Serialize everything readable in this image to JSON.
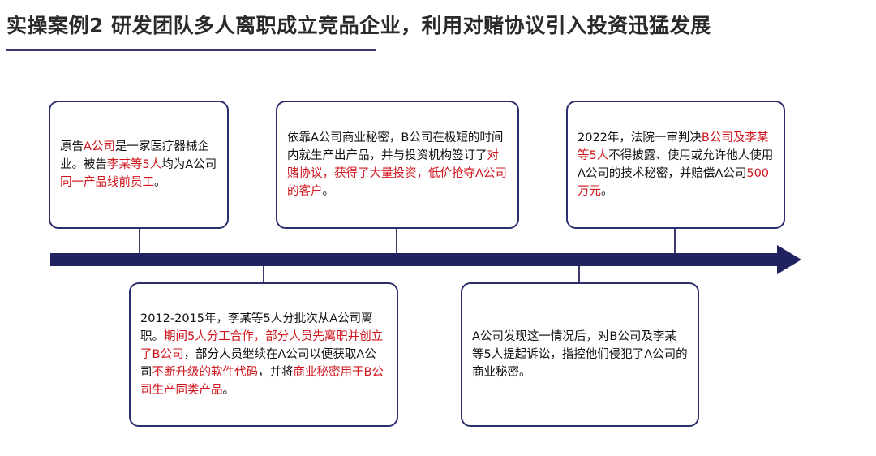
{
  "header": {
    "title": "实操案例2  研发团队多人离职成立竞品企业，利用对赌协议引入投资迅猛发展"
  },
  "timeline": {
    "colors": {
      "bar": "#212260",
      "border": "#2c2d6e",
      "highlight": "#d0141c"
    },
    "events": [
      {
        "position": "top",
        "segments": [
          {
            "text": "原告",
            "highlight": false
          },
          {
            "text": "A公司",
            "highlight": true
          },
          {
            "text": "是一家医疗器械企业。被告",
            "highlight": false
          },
          {
            "text": "李某等5人",
            "highlight": true
          },
          {
            "text": "均为A公司",
            "highlight": false
          },
          {
            "text": "同一产品线前员工",
            "highlight": true
          },
          {
            "text": "。",
            "highlight": false
          }
        ]
      },
      {
        "position": "bottom",
        "segments": [
          {
            "text": "2012-2015年，李某等5人分批次从A公司离职。",
            "highlight": false
          },
          {
            "text": "期间5人分工合作，部分人员先离职并创立了B公司",
            "highlight": true
          },
          {
            "text": "，部分人员继续在A公司以便获取A公司",
            "highlight": false
          },
          {
            "text": "不断升级的软件代码",
            "highlight": true
          },
          {
            "text": "，并将",
            "highlight": false
          },
          {
            "text": "商业秘密用于B公司生产同类产品",
            "highlight": true
          },
          {
            "text": "。",
            "highlight": false
          }
        ]
      },
      {
        "position": "top",
        "segments": [
          {
            "text": "依靠A公司商业秘密，B公司在极短的时间内就生产出产品，并与投资机构签订了",
            "highlight": false
          },
          {
            "text": "对赌协议，获得了大量投资，低价抢夺A公司的客户",
            "highlight": true
          },
          {
            "text": "。",
            "highlight": false
          }
        ]
      },
      {
        "position": "bottom",
        "segments": [
          {
            "text": "A公司发现这一情况后，对B公司及李某等5人提起诉讼，指控他们侵犯了A公司的商业秘密。",
            "highlight": false
          }
        ]
      },
      {
        "position": "top",
        "segments": [
          {
            "text": "2022年，法院一审判决",
            "highlight": false
          },
          {
            "text": "B公司及李某等5人",
            "highlight": true
          },
          {
            "text": "不得披露、使用或允许他人使用A公司的技术秘密，并赔偿A公司",
            "highlight": false
          },
          {
            "text": "500万元",
            "highlight": true
          },
          {
            "text": "。",
            "highlight": false
          }
        ]
      }
    ]
  }
}
